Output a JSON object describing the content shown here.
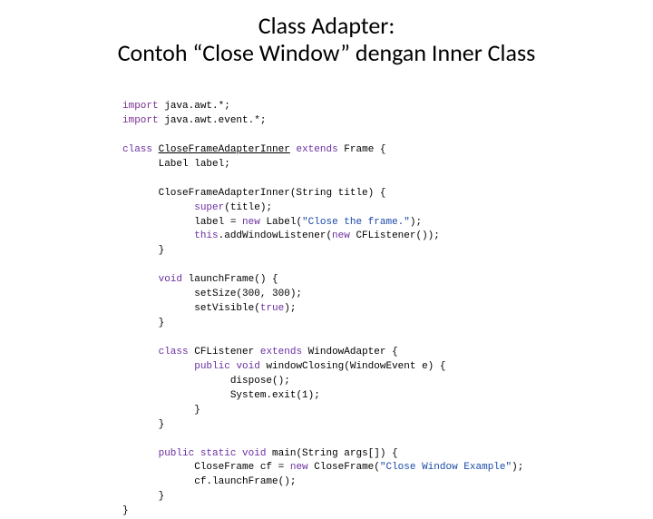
{
  "title": {
    "line1": "Class Adapter:",
    "line2": "Contoh “Close Window” dengan Inner Class"
  },
  "code": {
    "import": "import",
    "pkg1": "java.awt.*;",
    "pkg2": "java.awt.event.*;",
    "class_kw": "class",
    "classname": "CloseFrameAdapterInner",
    "extends": "extends",
    "frame": "Frame {",
    "label_decl": "Label label;",
    "ctor": "CloseFrameAdapterInner(String title) {",
    "super_kw": "super",
    "super_arg": "(title);",
    "label_assign_a": "label = ",
    "new_kw": "new",
    "label_assign_b": " Label(",
    "label_str": "\"Close the frame.\"",
    "label_assign_c": ");",
    "this_kw": "this",
    "addlistener_a": ".addWindowListener(",
    "addlistener_b": " CFListener());",
    "rbrace": "}",
    "void_kw": "void",
    "launchframe": " launchFrame() {",
    "setsize": "setSize(300, 300);",
    "setvisible_a": "setVisible(",
    "true_kw": "true",
    "setvisible_b": ");",
    "cflistener_a": " CFListener ",
    "windowadapter": "WindowAdapter {",
    "public_kw": "public",
    "windowclosing": " windowClosing(WindowEvent e) {",
    "dispose": "dispose();",
    "systemexit": "System.exit(1);",
    "static_kw": "static",
    "main": " main(String args[]) {",
    "cf_a": "CloseFrame cf = ",
    "cf_b": " CloseFrame(",
    "cf_str": "\"Close Window Example\"",
    "cf_c": ");",
    "cf_launch": "cf.launchFrame();"
  }
}
